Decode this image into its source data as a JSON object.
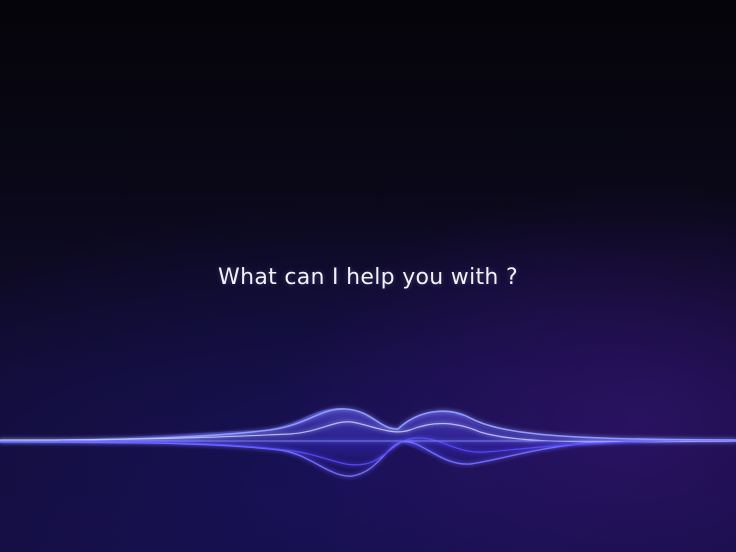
{
  "assistant": {
    "prompt": "What can I help you with ?"
  },
  "theme": {
    "background": "#0b0920",
    "wave_primary": "#4d4dff",
    "wave_highlight": "#b8c4ff"
  },
  "waveform": {
    "icon": "voice-waveform-icon"
  }
}
